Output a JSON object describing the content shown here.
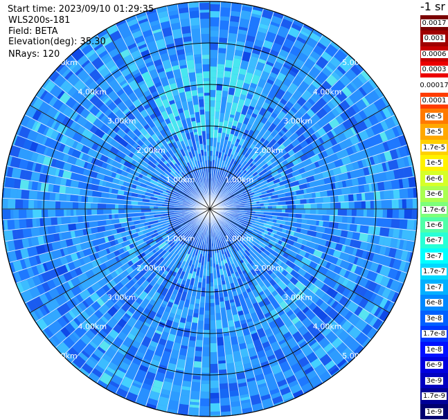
{
  "info": {
    "start_time": "Start time: 2023/09/10 01:29:35",
    "instrument": "WLS200s-181",
    "field": "Field: BETA",
    "elevation": "Elevation(deg): 35.30",
    "nrays": "NRays: 120"
  },
  "colorbar": {
    "title": "-1 sr",
    "levels": [
      "0.0017",
      "0.001",
      "0.0006",
      "0.0003",
      "0.00017",
      "0.0001",
      "6e-5",
      "3e-5",
      "1.7e-5",
      "1e-5",
      "6e-6",
      "3e-6",
      "1.7e-6",
      "1e-6",
      "6e-7",
      "3e-7",
      "1.7e-7",
      "1e-7",
      "6e-8",
      "3e-8",
      "1.7e-8",
      "1e-8",
      "6e-9",
      "3e-9",
      "1.7e-9",
      "1e-9"
    ],
    "colors": [
      "#7a0000",
      "#a00000",
      "#c80000",
      "#ec0000",
      "#ffffff",
      "#ff3c00",
      "#ff7a00",
      "#ffa800",
      "#ffd000",
      "#fff200",
      "#d6ff28",
      "#aaff50",
      "#7dff7a",
      "#50ffa8",
      "#28ffd6",
      "#00ffff",
      "#00d8ff",
      "#00b0ff",
      "#0088ff",
      "#0060ff",
      "#0038ff",
      "#0010ff",
      "#0000e0",
      "#0000c0",
      "#000096",
      "#000070"
    ]
  },
  "ppi": {
    "rings": [
      {
        "label": "1.00km"
      },
      {
        "label": "2.00km"
      },
      {
        "label": "3.00km"
      },
      {
        "label": "4.00km"
      },
      {
        "label": "5.00km"
      }
    ]
  }
}
